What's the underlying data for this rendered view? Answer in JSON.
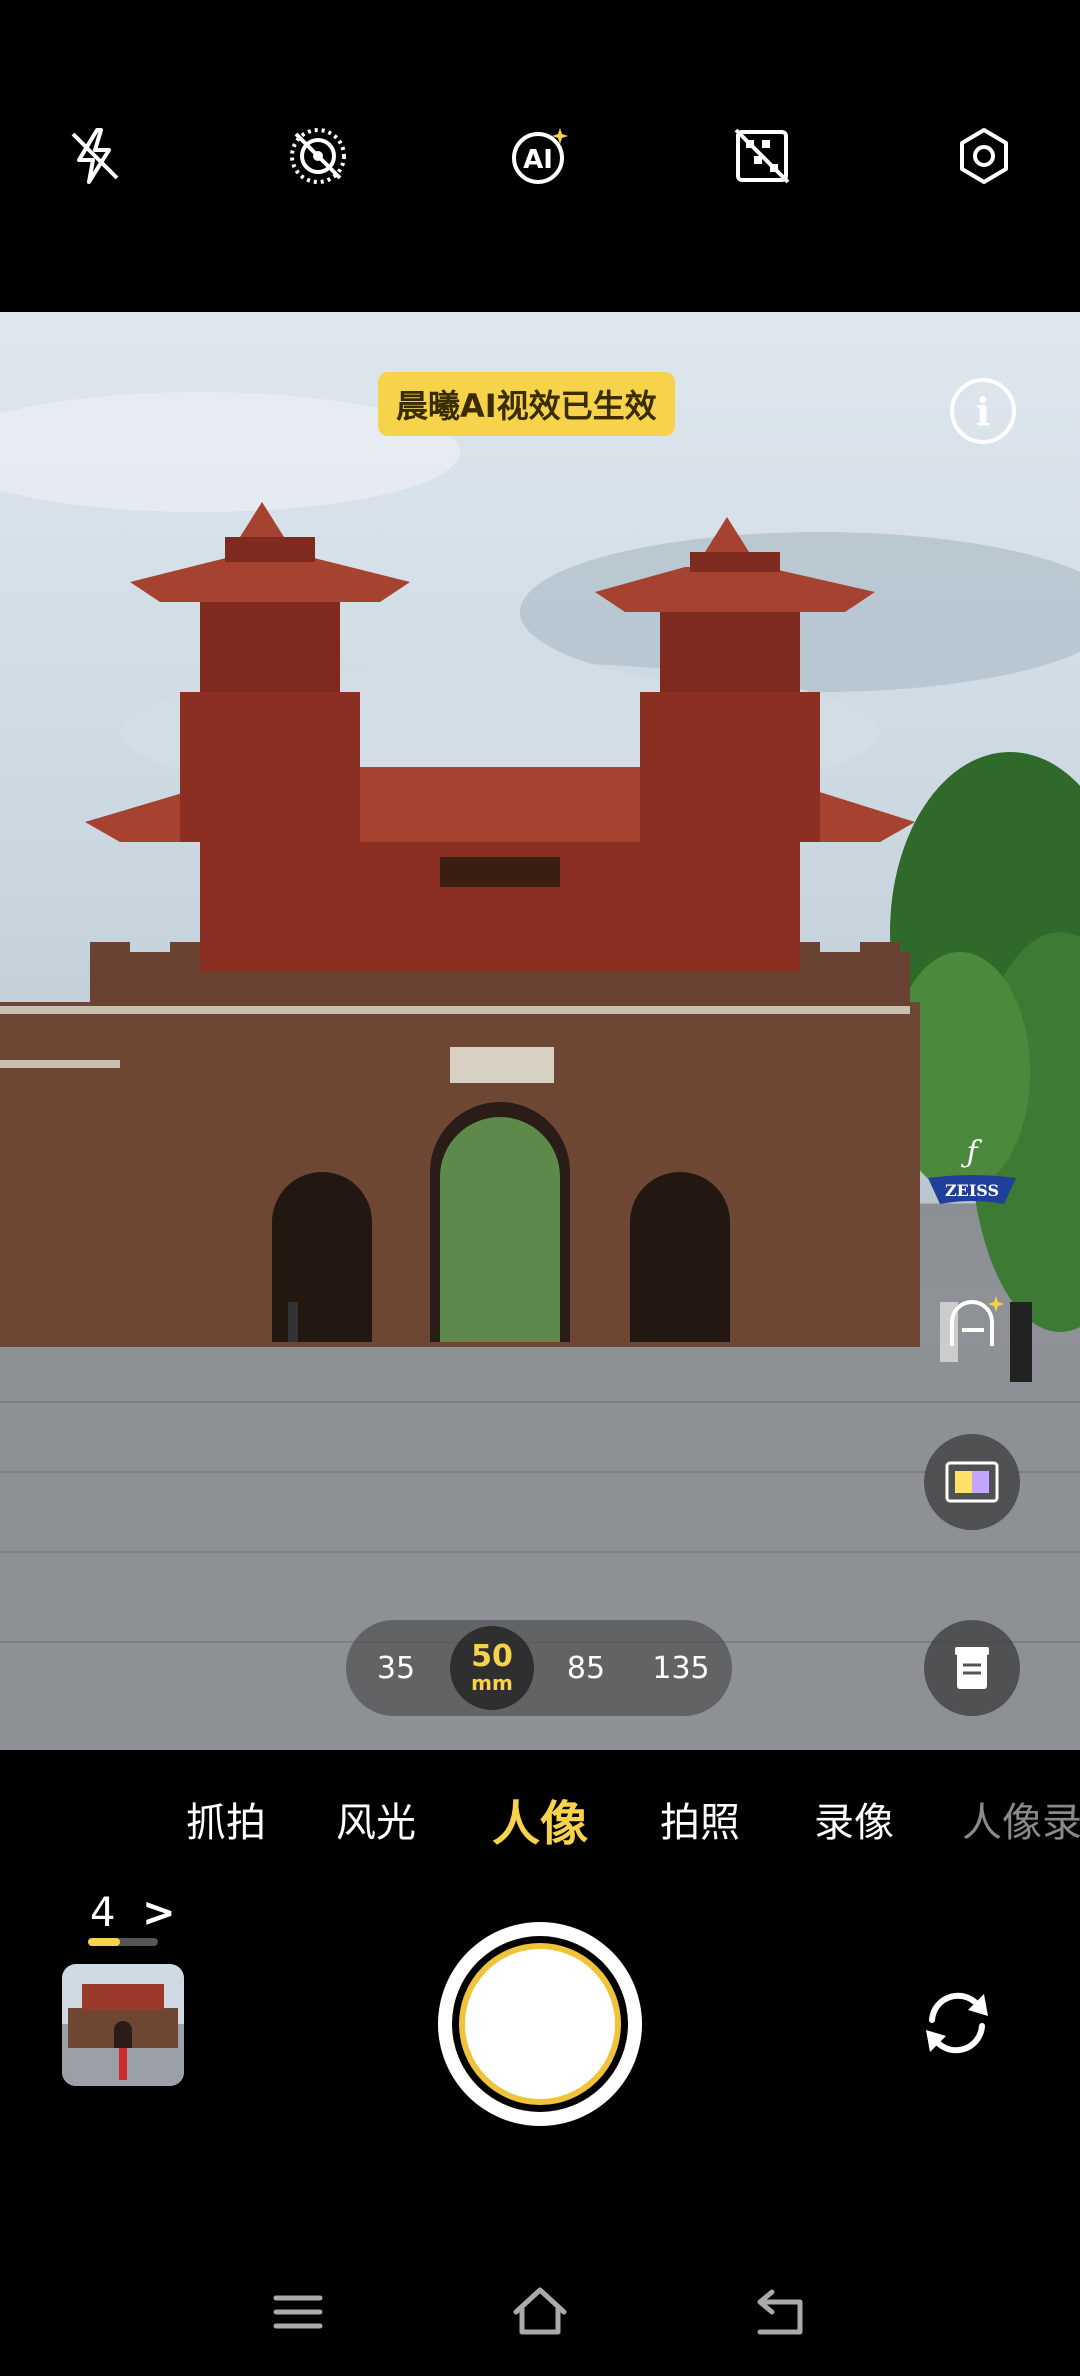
{
  "top_bar": {
    "icons": [
      "flash-off-icon",
      "live-photo-off-icon",
      "ai-icon",
      "filter-off-icon",
      "settings-icon"
    ]
  },
  "viewfinder": {
    "ai_badge": "晨曦AI视效已生效",
    "info_icon": "i",
    "zeiss": {
      "f_glyph": "ƒ",
      "brand": "ZEISS"
    },
    "focal_lengths": [
      "35",
      "50",
      "85",
      "135"
    ],
    "focal_selected": "50",
    "focal_unit": "mm"
  },
  "modes": {
    "items": [
      "抓拍",
      "风光",
      "人像",
      "拍照",
      "录像",
      "人像录"
    ],
    "active": "人像"
  },
  "gallery": {
    "count": "4",
    "chevron": ">",
    "progress": 0.45
  },
  "colors": {
    "accent": "#f6d34a",
    "shutter_ring": "#f0c43a"
  }
}
